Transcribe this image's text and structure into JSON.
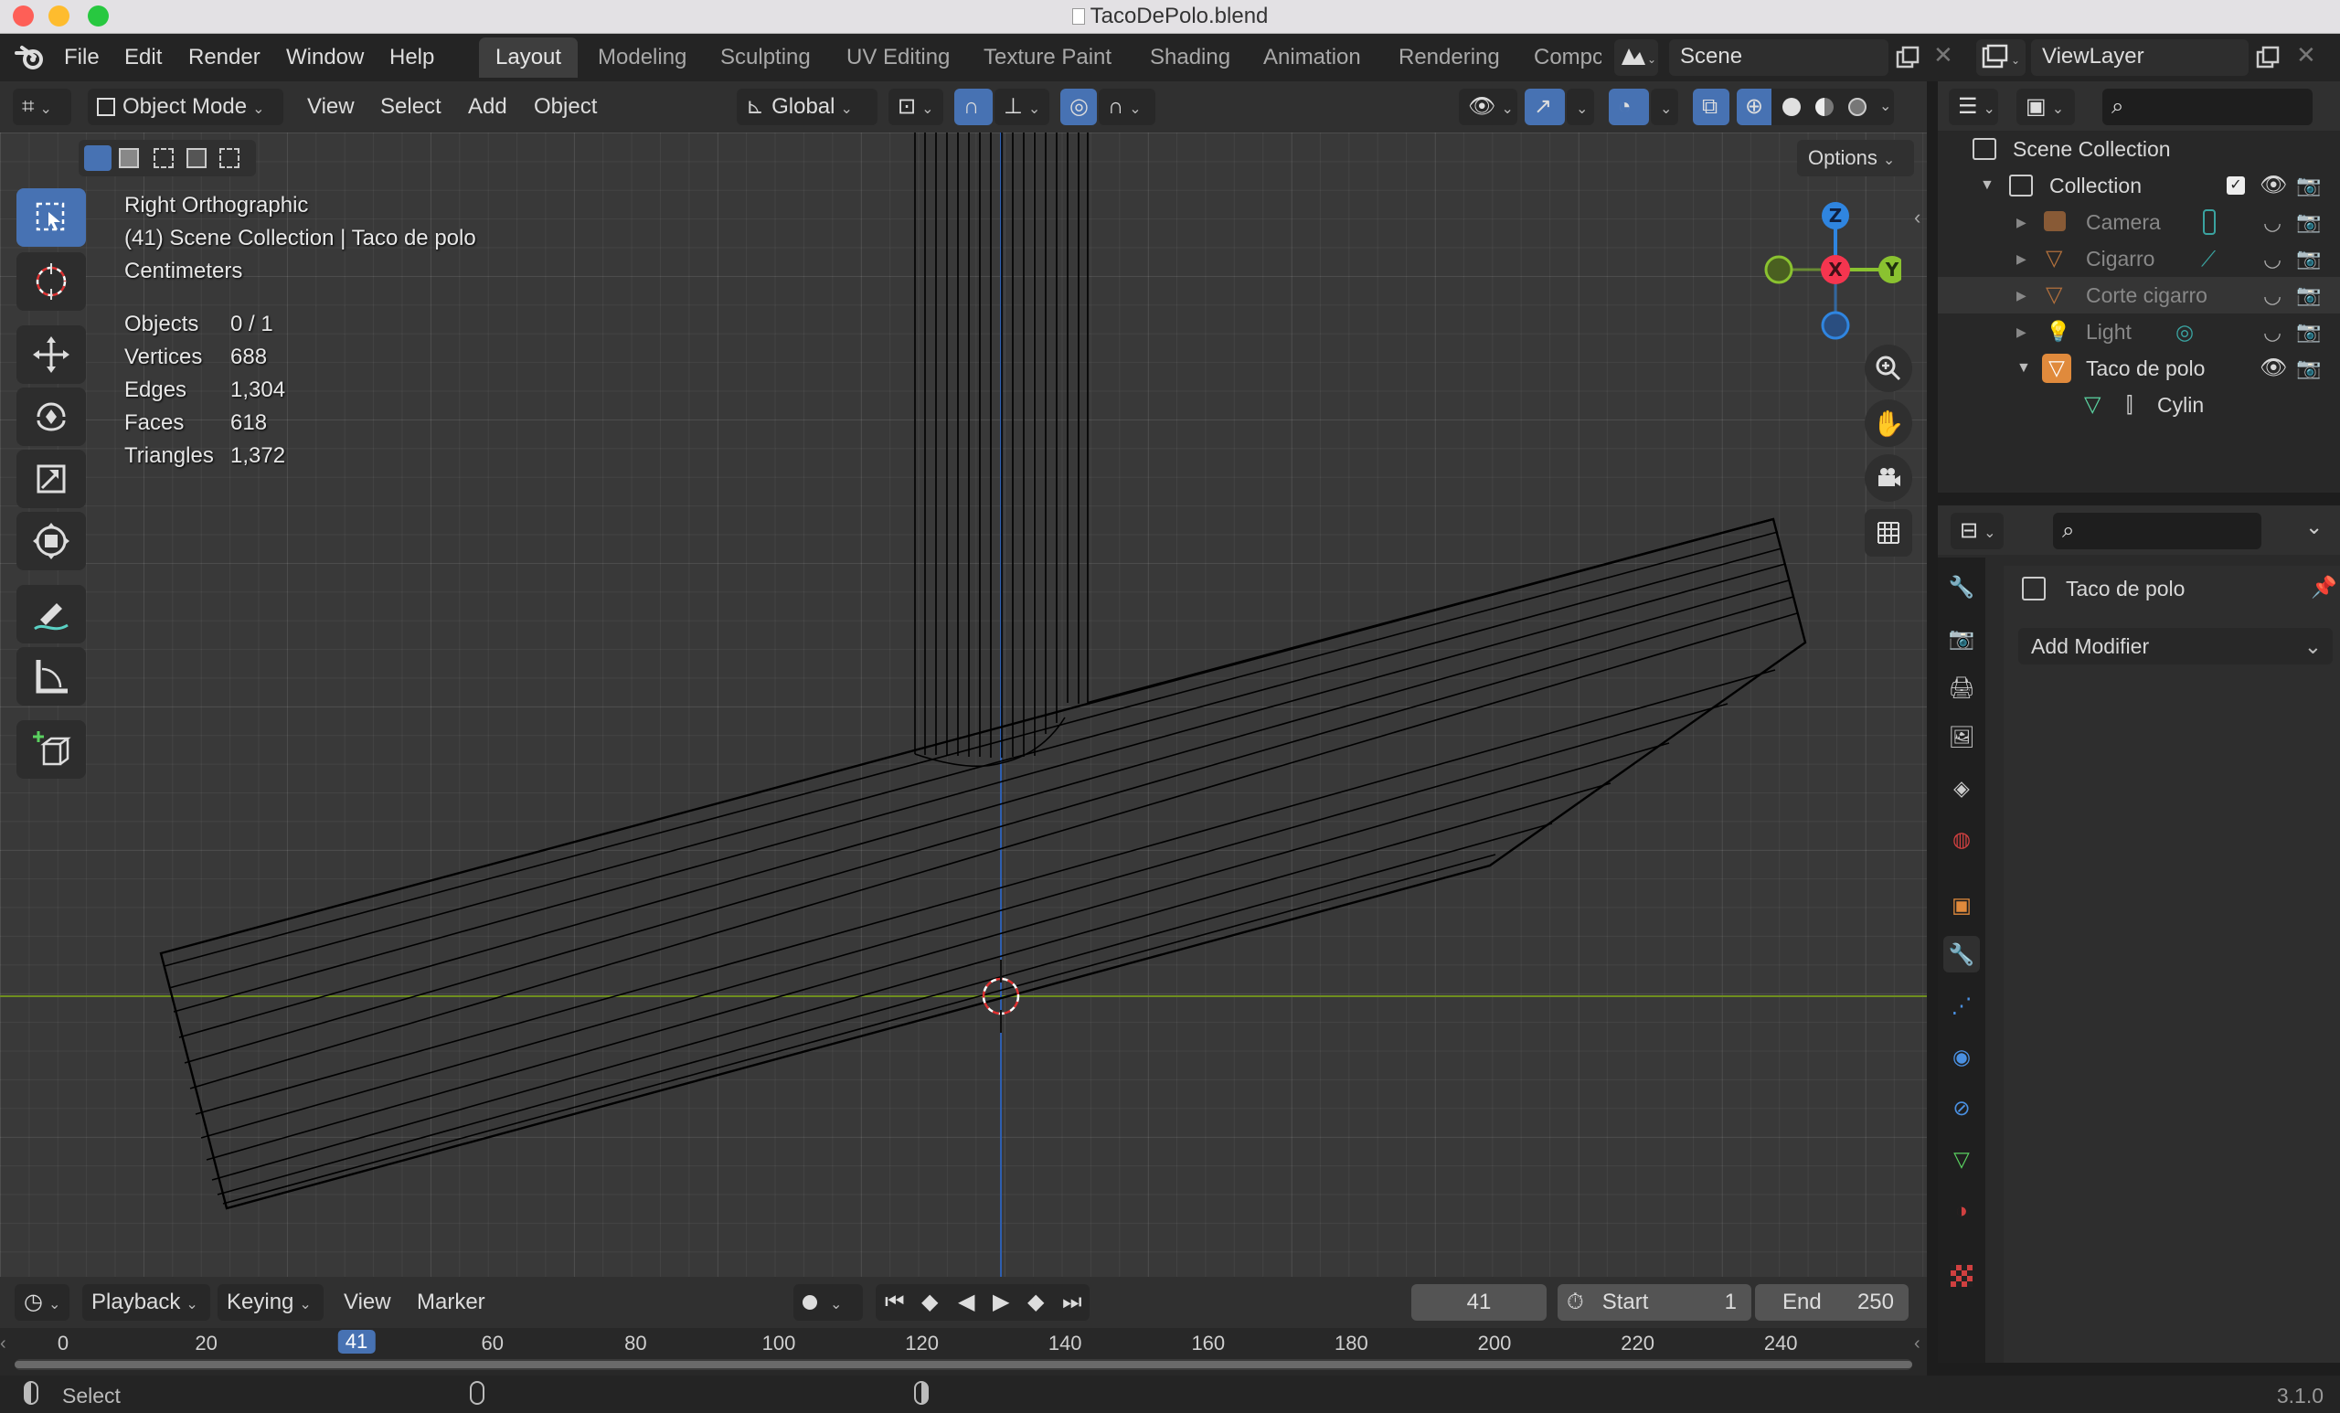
{
  "window": {
    "title": "TacoDePolo.blend"
  },
  "menu": {
    "file": "File",
    "edit": "Edit",
    "render": "Render",
    "window": "Window",
    "help": "Help"
  },
  "workspaces": [
    "Layout",
    "Modeling",
    "Sculpting",
    "UV Editing",
    "Texture Paint",
    "Shading",
    "Animation",
    "Rendering",
    "Compc"
  ],
  "scene": {
    "name": "Scene"
  },
  "viewlayer": {
    "name": "ViewLayer"
  },
  "viewport_header": {
    "mode": "Object Mode",
    "view": "View",
    "select": "Select",
    "add": "Add",
    "object": "Object",
    "orientation": "Global",
    "options": "Options"
  },
  "overlay_info": {
    "view_name": "Right Orthographic",
    "collection_line": "(41) Scene Collection | Taco de polo",
    "units": "Centimeters",
    "stats": [
      {
        "label": "Objects",
        "value": "0 / 1"
      },
      {
        "label": "Vertices",
        "value": "688"
      },
      {
        "label": "Edges",
        "value": "1,304"
      },
      {
        "label": "Faces",
        "value": "618"
      },
      {
        "label": "Triangles",
        "value": "1,372"
      }
    ]
  },
  "gizmo": {
    "z": "Z",
    "x": "X",
    "y": "Y"
  },
  "outliner": {
    "root": "Scene Collection",
    "collection": "Collection",
    "items": [
      {
        "name": "Camera",
        "dim": true
      },
      {
        "name": "Cigarro",
        "dim": true
      },
      {
        "name": "Corte cigarro",
        "dim": true
      },
      {
        "name": "Light",
        "dim": true
      },
      {
        "name": "Taco de polo",
        "dim": false
      }
    ],
    "child": "Cylin"
  },
  "properties": {
    "object_name": "Taco de polo",
    "add_modifier": "Add Modifier"
  },
  "timeline": {
    "playback": "Playback",
    "keying": "Keying",
    "view": "View",
    "marker": "Marker",
    "current_frame": "41",
    "start_label": "Start",
    "start": "1",
    "end_label": "End",
    "end": "250",
    "ticks": [
      "0",
      "20",
      "41",
      "60",
      "80",
      "100",
      "120",
      "140",
      "160",
      "180",
      "200",
      "220",
      "240"
    ]
  },
  "status": {
    "select": "Select",
    "version": "3.1.0"
  },
  "colors": {
    "accent": "#4772b3",
    "x_axis": "#f5354f",
    "y_axis": "#8ac230",
    "z_axis": "#2f85e0",
    "mesh_wire": "#000000"
  }
}
